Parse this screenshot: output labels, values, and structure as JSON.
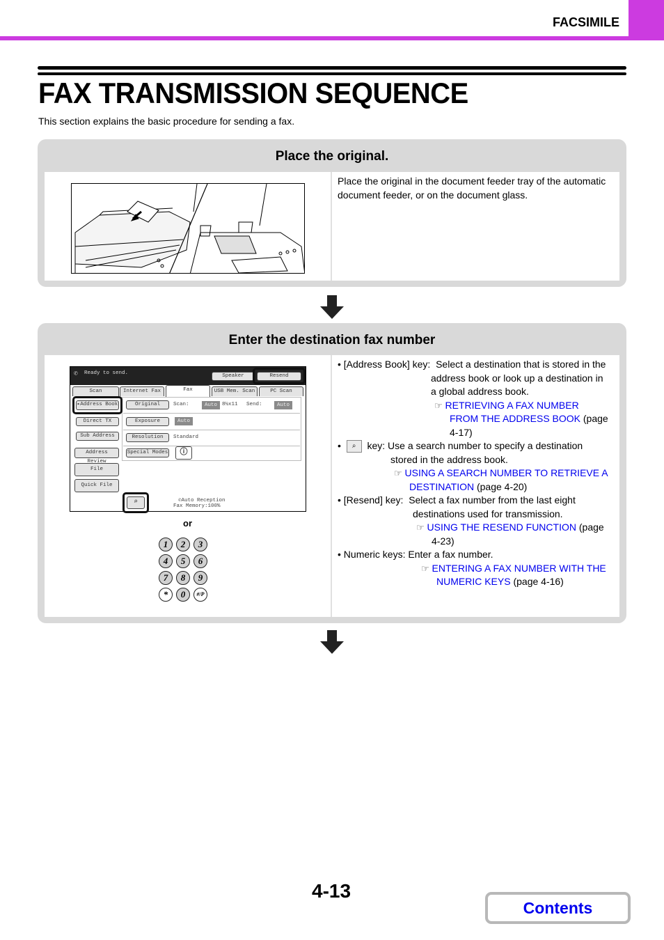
{
  "header": {
    "section_label": "FACSIMILE",
    "accent_color": "#cc3be0"
  },
  "page_title": "FAX TRANSMISSION SEQUENCE",
  "intro": "This section explains the basic procedure for sending a fax.",
  "steps": [
    {
      "title": "Place the original.",
      "description": "Place the original in the document feeder tray of the automatic document feeder, or on the document glass.",
      "illustration": "document-feeder-and-glass-illustration"
    },
    {
      "title": "Enter the destination fax number",
      "panel": {
        "status": "Ready to send.",
        "speaker_button": "Speaker",
        "resend_button": "Resend",
        "tabs": [
          "Scan",
          "Internet Fax",
          "Fax",
          "USB Mem. Scan",
          "PC Scan"
        ],
        "active_tab": "Fax",
        "left_buttons": [
          "Address Book",
          "Direct TX",
          "Sub Address",
          "Address Review",
          "File",
          "Quick File"
        ],
        "settings": {
          "original_label": "Original",
          "scan_label": "Scan:",
          "scan_value": "Auto",
          "paper_size": "8½x11",
          "send_label": "Send:",
          "send_value": "Auto",
          "exposure_label": "Exposure",
          "exposure_value": "Auto",
          "resolution_label": "Resolution",
          "resolution_value": "Standard",
          "special_modes_label": "Special Modes"
        },
        "reception_mode": "Auto Reception",
        "fax_memory": "Fax Memory:100%"
      },
      "or_label": "or",
      "keypad": [
        "1",
        "2",
        "3",
        "4",
        "5",
        "6",
        "7",
        "8",
        "9",
        "*",
        "0",
        "#/P"
      ],
      "bullets": [
        {
          "key": "[Address Book] key:",
          "text": "Select a destination that is stored in the address book or look up a destination in a global address book.",
          "link": "RETRIEVING A FAX NUMBER FROM THE ADDRESS BOOK",
          "page": "(page 4-17)"
        },
        {
          "key": "key:",
          "key_icon": "search-number-key-icon",
          "text": "Use a search number to specify a destination stored in the address book.",
          "link": "USING A SEARCH NUMBER TO RETRIEVE A DESTINATION",
          "page": "(page 4-20)"
        },
        {
          "key": "[Resend] key:",
          "text": "Select a fax number from the last eight destinations used for transmission.",
          "link": "USING THE RESEND FUNCTION",
          "page": "(page 4-23)"
        },
        {
          "key": "Numeric keys:",
          "text": "Enter a fax number.",
          "link": "ENTERING A FAX NUMBER WITH THE NUMERIC KEYS",
          "page": "(page 4-16)"
        }
      ]
    }
  ],
  "footer": {
    "page_number": "4-13",
    "contents_button": "Contents",
    "link_color": "#0000ee"
  }
}
